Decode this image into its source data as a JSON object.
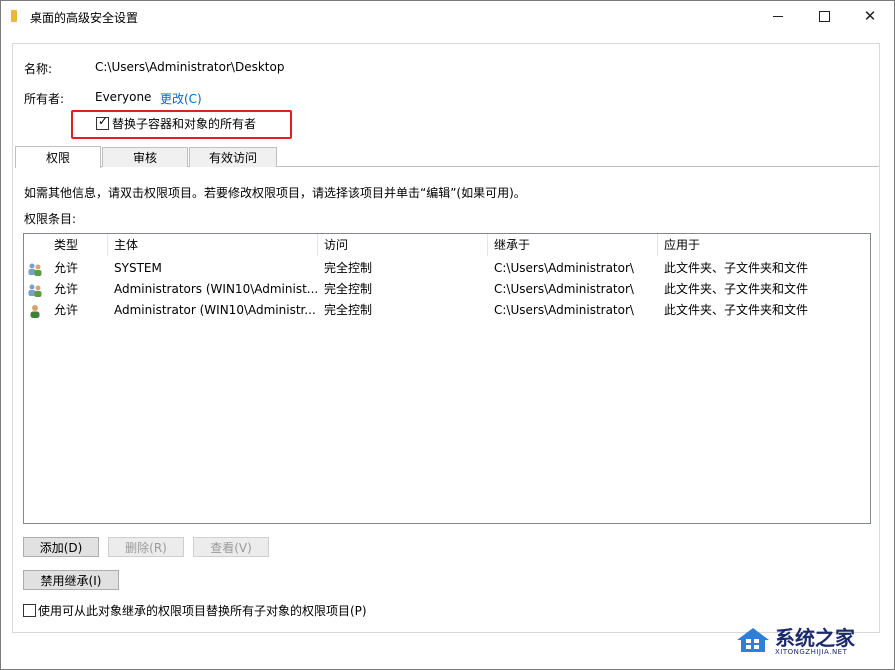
{
  "window": {
    "title": "桌面的高级安全设置"
  },
  "name_row": {
    "label": "名称:",
    "value": "C:\\Users\\Administrator\\Desktop"
  },
  "owner_row": {
    "label": "所有者:",
    "value": "Everyone",
    "change_link": "更改(C)"
  },
  "replace_owner": {
    "label": "替换子容器和对象的所有者",
    "checked": true
  },
  "tabs": [
    {
      "label": "权限",
      "active": true
    },
    {
      "label": "审核",
      "active": false
    },
    {
      "label": "有效访问",
      "active": false
    }
  ],
  "info_text": "如需其他信息，请双击权限项目。若要修改权限项目，请选择该项目并单击“编辑”(如果可用)。",
  "entries_label": "权限条目:",
  "table": {
    "columns": [
      "类型",
      "主体",
      "访问",
      "继承于",
      "应用于"
    ],
    "rows": [
      {
        "icon": "group-user-icon",
        "type": "允许",
        "principal": "SYSTEM",
        "access": "完全控制",
        "inherited": "C:\\Users\\Administrator\\",
        "applies": "此文件夹、子文件夹和文件"
      },
      {
        "icon": "group-user-icon",
        "type": "允许",
        "principal": "Administrators (WIN10\\Administ...",
        "access": "完全控制",
        "inherited": "C:\\Users\\Administrator\\",
        "applies": "此文件夹、子文件夹和文件"
      },
      {
        "icon": "single-user-icon",
        "type": "允许",
        "principal": "Administrator (WIN10\\Administr...",
        "access": "完全控制",
        "inherited": "C:\\Users\\Administrator\\",
        "applies": "此文件夹、子文件夹和文件"
      }
    ]
  },
  "buttons": {
    "add": "添加(D)",
    "remove": "删除(R)",
    "view": "查看(V)",
    "disable_inheritance": "禁用继承(I)"
  },
  "replace_children": {
    "label": "使用可从此对象继承的权限项目替换所有子对象的权限项目(P)",
    "checked": false
  },
  "watermark": {
    "text": "系统之家",
    "sub": "XITONGZHIJIA.NET"
  }
}
